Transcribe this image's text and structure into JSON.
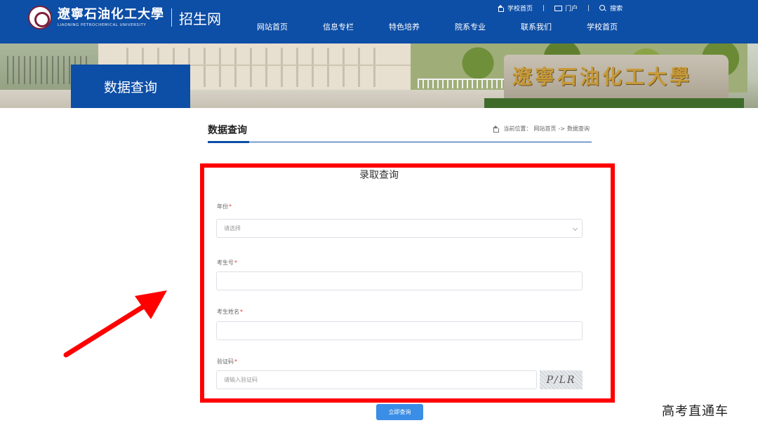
{
  "header": {
    "logo_cn": "遼寧石油化工大學",
    "logo_en": "LIAONING PETROCHEMICAL UNIVERSITY",
    "site_name": "招生网",
    "top_links": [
      {
        "label": "学校首页",
        "icon": "home-icon"
      },
      {
        "label": "门户",
        "icon": "portal-icon"
      },
      {
        "label": "搜索",
        "icon": "search-icon"
      }
    ],
    "nav": [
      "网站首页",
      "信息专栏",
      "特色培养",
      "院系专业",
      "联系我们",
      "学校首页"
    ]
  },
  "banner": {
    "label": "数据查询",
    "stone_text": "遼寧石油化工大學"
  },
  "section": {
    "title": "数据查询",
    "breadcrumb_prefix": "当前位置：",
    "breadcrumb_home": "网站首页",
    "breadcrumb_sep": "->",
    "breadcrumb_current": "数据查询"
  },
  "form": {
    "title": "录取查询",
    "year_label": "年份",
    "year_placeholder": "请选择",
    "exam_no_label": "考生号",
    "exam_no_value": "",
    "name_label": "考生姓名",
    "name_value": "",
    "captcha_label": "验证码",
    "captcha_placeholder": "请输入验证码",
    "captcha_text": "P/LR",
    "required_mark": "*",
    "submit_label": "立即查询"
  },
  "colors": {
    "brand_blue": "#0d4ea6",
    "highlight_red": "#ff0000",
    "button_blue": "#3a8ee6"
  },
  "watermark": "高考直通车"
}
